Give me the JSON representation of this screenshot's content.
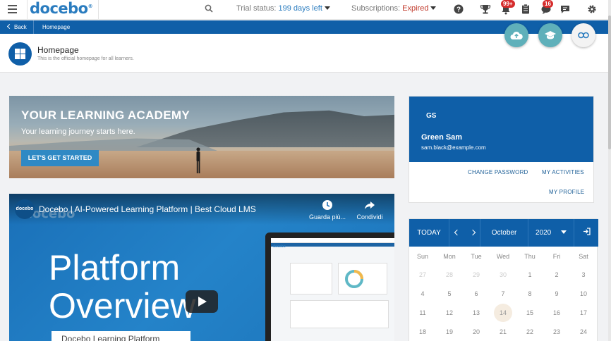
{
  "brand": {
    "logo": "docebo",
    "primary": "#0f5fa8",
    "accent": "#2a7cbf",
    "expired_color": "#c0392b"
  },
  "topbar": {
    "trial_label": "Trial status:",
    "trial_value": "199 days left",
    "subs_label": "Subscriptions:",
    "subs_value": "Expired",
    "notif_badge": "99+",
    "messages_badge": "16"
  },
  "breadcrumb": {
    "back_label": "Back",
    "current": "Homepage"
  },
  "page": {
    "title": "Homepage",
    "subtitle": "This is the official homepage for all learners."
  },
  "hero": {
    "title": "YOUR LEARNING ACADEMY",
    "subtitle": "Your learning journey starts here.",
    "cta": "LET'S GET STARTED"
  },
  "video": {
    "channel": "docebo",
    "title": "Docebo | AI-Powered Learning Platform | Best Cloud LMS",
    "watch_later": "Guarda più...",
    "share": "Condividi",
    "headline_1": "Platform",
    "headline_2": "Overview",
    "caption": "Docebo Learning Platform",
    "laptop_logo": "docebo"
  },
  "profile": {
    "initials": "GS",
    "name": "Green Sam",
    "email": "sam.black@example.com",
    "change_password": "CHANGE PASSWORD",
    "my_activities": "MY ACTIVITIES",
    "my_profile": "MY PROFILE"
  },
  "calendar": {
    "today_label": "TODAY",
    "month": "October",
    "year": "2020",
    "weekdays": [
      "Sun",
      "Mon",
      "Tue",
      "Wed",
      "Thu",
      "Fri",
      "Sat"
    ],
    "weeks": [
      [
        "27",
        "28",
        "29",
        "30",
        "1",
        "2",
        "3"
      ],
      [
        "4",
        "5",
        "6",
        "7",
        "8",
        "9",
        "10"
      ],
      [
        "11",
        "12",
        "13",
        "14",
        "15",
        "16",
        "17"
      ],
      [
        "18",
        "19",
        "20",
        "21",
        "22",
        "23",
        "24"
      ]
    ],
    "today": "14"
  }
}
